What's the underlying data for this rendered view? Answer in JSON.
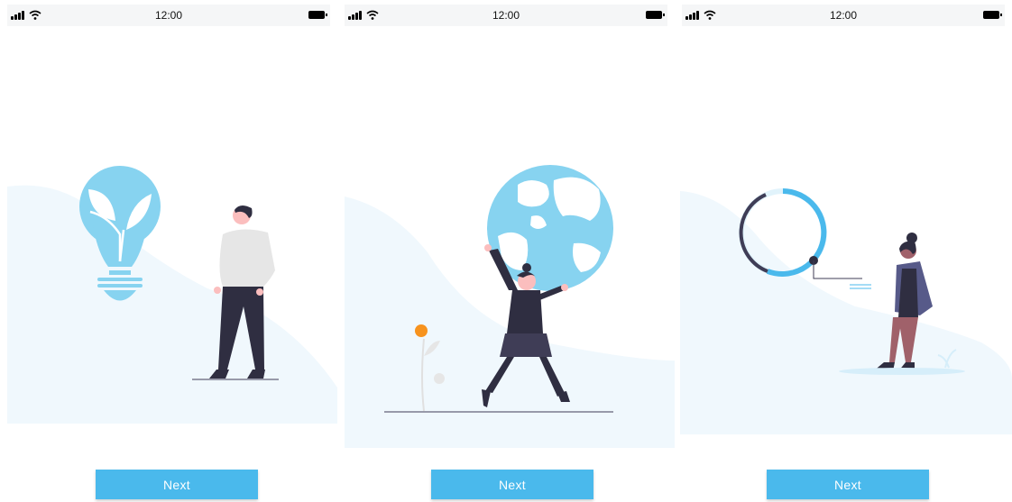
{
  "colors": {
    "accent": "#4ab9ec",
    "illustration_blue": "#87d3f0",
    "background_wave": "#f0f8fd",
    "dark_figure": "#2f2e41",
    "accent_orange": "#f7931e"
  },
  "screens": [
    {
      "status": {
        "time": "12:00"
      },
      "illustration": "lightbulb-with-leaves-and-person",
      "next_label": "Next"
    },
    {
      "status": {
        "time": "12:00"
      },
      "illustration": "woman-holding-globe",
      "next_label": "Next"
    },
    {
      "status": {
        "time": "12:00"
      },
      "illustration": "woman-with-progress-ring",
      "next_label": "Next"
    }
  ]
}
